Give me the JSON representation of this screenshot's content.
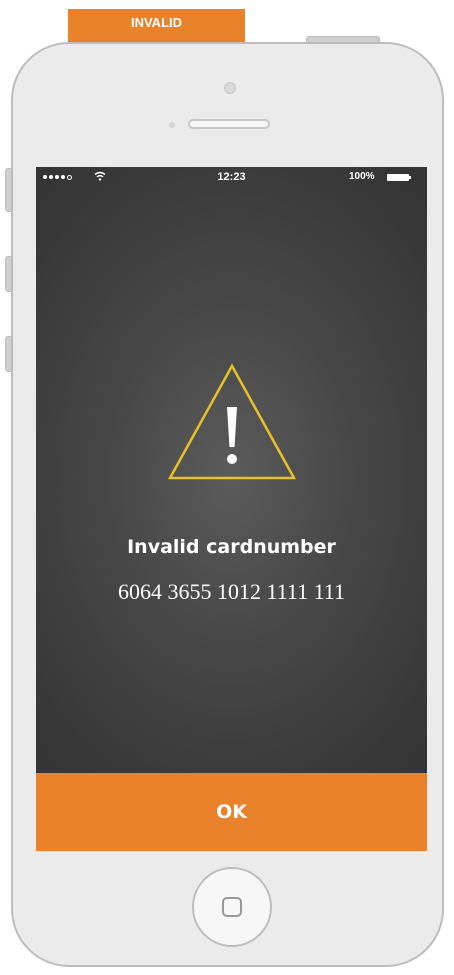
{
  "banner": {
    "label": "INVALID"
  },
  "status_bar": {
    "time": "12:23",
    "battery_percent": "100%",
    "signal_bars": 4,
    "icons": {
      "wifi": "wifi-icon",
      "battery": "battery-icon"
    }
  },
  "alert": {
    "icon": "warning-triangle-icon",
    "title": "Invalid cardnumber",
    "card_number": "6064 3655 1012 1111 111",
    "ok_label": "OK"
  },
  "colors": {
    "accent": "#e9822a",
    "warning": "#e8c02a",
    "screen_bg": "#474747",
    "device_body": "#ebebeb"
  }
}
